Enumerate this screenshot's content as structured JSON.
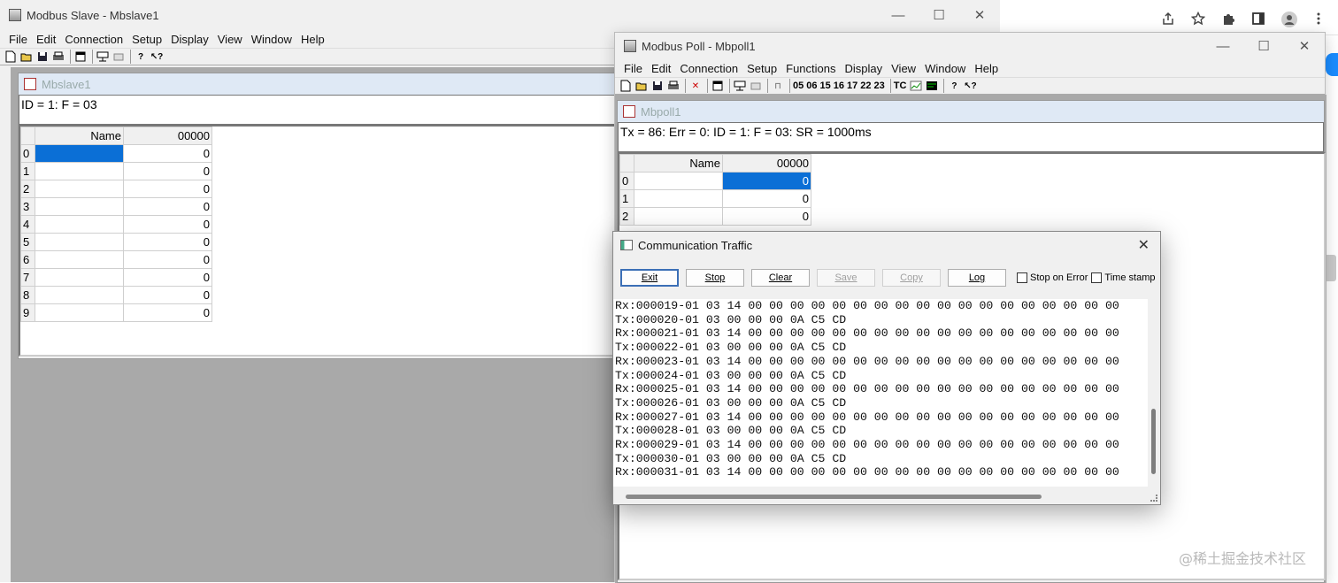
{
  "slave": {
    "title": "Modbus Slave - Mbslave1",
    "menu": [
      "File",
      "Edit",
      "Connection",
      "Setup",
      "Display",
      "View",
      "Window",
      "Help"
    ],
    "child_title": "Mbslave1",
    "status": "ID = 1: F = 03",
    "grid": {
      "header_name": "Name",
      "header_addr": "00000",
      "rows": [
        {
          "idx": "0",
          "name": "",
          "value": "0"
        },
        {
          "idx": "1",
          "name": "",
          "value": "0"
        },
        {
          "idx": "2",
          "name": "",
          "value": "0"
        },
        {
          "idx": "3",
          "name": "",
          "value": "0"
        },
        {
          "idx": "4",
          "name": "",
          "value": "0"
        },
        {
          "idx": "5",
          "name": "",
          "value": "0"
        },
        {
          "idx": "6",
          "name": "",
          "value": "0"
        },
        {
          "idx": "7",
          "name": "",
          "value": "0"
        },
        {
          "idx": "8",
          "name": "",
          "value": "0"
        },
        {
          "idx": "9",
          "name": "",
          "value": "0"
        }
      ]
    }
  },
  "poll": {
    "title": "Modbus Poll - Mbpoll1",
    "menu": [
      "File",
      "Edit",
      "Connection",
      "Setup",
      "Functions",
      "Display",
      "View",
      "Window",
      "Help"
    ],
    "toolbar_codes": [
      "05",
      "06",
      "15",
      "16",
      "17",
      "22",
      "23",
      "TC"
    ],
    "child_title": "Mbpoll1",
    "status": "Tx = 86: Err = 0: ID = 1: F = 03: SR = 1000ms",
    "grid": {
      "header_name": "Name",
      "header_addr": "00000",
      "rows": [
        {
          "idx": "0",
          "name": "",
          "value": "0"
        },
        {
          "idx": "1",
          "name": "",
          "value": "0"
        },
        {
          "idx": "2",
          "name": "",
          "value": "0"
        }
      ]
    }
  },
  "traffic": {
    "title": "Communication Traffic",
    "buttons": {
      "exit": "Exit",
      "stop": "Stop",
      "clear": "Clear",
      "save": "Save",
      "copy": "Copy",
      "log": "Log"
    },
    "stop_on_error": "Stop on Error",
    "time_stamp": "Time stamp",
    "lines": [
      "Rx:000019-01 03 14 00 00 00 00 00 00 00 00 00 00 00 00 00 00 00 00 00 00",
      "Tx:000020-01 03 00 00 00 0A C5 CD",
      "Rx:000021-01 03 14 00 00 00 00 00 00 00 00 00 00 00 00 00 00 00 00 00 00",
      "Tx:000022-01 03 00 00 00 0A C5 CD",
      "Rx:000023-01 03 14 00 00 00 00 00 00 00 00 00 00 00 00 00 00 00 00 00 00",
      "Tx:000024-01 03 00 00 00 0A C5 CD",
      "Rx:000025-01 03 14 00 00 00 00 00 00 00 00 00 00 00 00 00 00 00 00 00 00",
      "Tx:000026-01 03 00 00 00 0A C5 CD",
      "Rx:000027-01 03 14 00 00 00 00 00 00 00 00 00 00 00 00 00 00 00 00 00 00",
      "Tx:000028-01 03 00 00 00 0A C5 CD",
      "Rx:000029-01 03 14 00 00 00 00 00 00 00 00 00 00 00 00 00 00 00 00 00 00",
      "Tx:000030-01 03 00 00 00 0A C5 CD",
      "Rx:000031-01 03 14 00 00 00 00 00 00 00 00 00 00 00 00 00 00 00 00 00 00"
    ]
  },
  "watermark": "@稀土掘金技术社区",
  "colors": {
    "selection": "#0b6fd6",
    "mdi_background": "#a9a9a9",
    "browser_accent": "#1a8cff"
  }
}
